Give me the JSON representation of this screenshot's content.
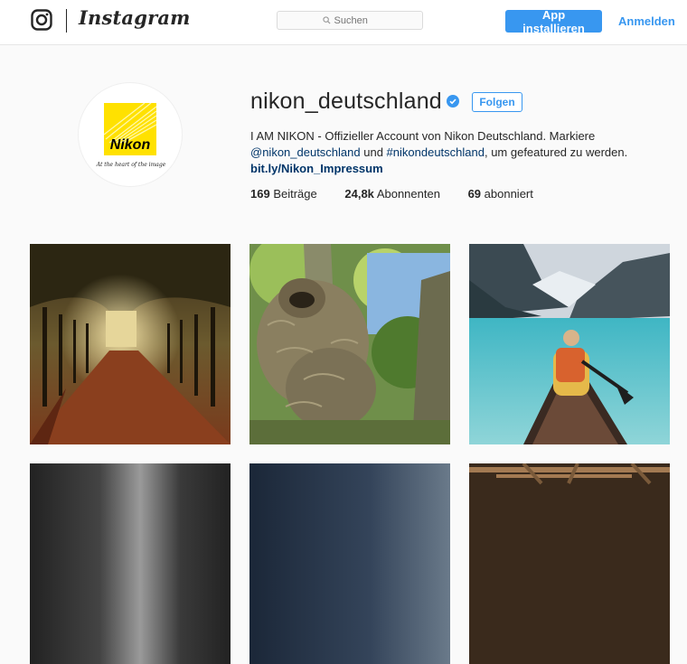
{
  "nav": {
    "wordmark": "Instagram",
    "search_placeholder": "Suchen",
    "install_label": "App installieren",
    "login_label": "Anmelden"
  },
  "profile": {
    "username": "nikon_deutschland",
    "follow_label": "Folgen",
    "avatar_brand": "Nikon",
    "avatar_tagline": "At the heart of the image",
    "bio_line1": "I AM NIKON - Offizieller Account von Nikon Deutschland. Markiere",
    "bio_mention": "@nikon_deutschland",
    "bio_und": " und ",
    "bio_hashtag": "#nikondeutschland",
    "bio_end": ", um gefeatured zu werden.",
    "website": "bit.ly/Nikon_Impressum",
    "stats": {
      "posts_count": "169",
      "posts_label": " Beiträge",
      "followers_count": "24,8k",
      "followers_label": " Abonnenten",
      "following_count": "69",
      "following_label": " abonniert"
    }
  },
  "colors": {
    "accent": "#3897f0",
    "link": "#003569",
    "nikon_yellow": "#ffe100"
  },
  "posts": [
    {
      "subject": "autumn tree-lined alley"
    },
    {
      "subject": "sloth in a tree"
    },
    {
      "subject": "woman in canoe on mountain lake"
    },
    {
      "subject": "dark blurred photo"
    },
    {
      "subject": "night sky photo"
    },
    {
      "subject": "wooden ceiling photo"
    }
  ]
}
